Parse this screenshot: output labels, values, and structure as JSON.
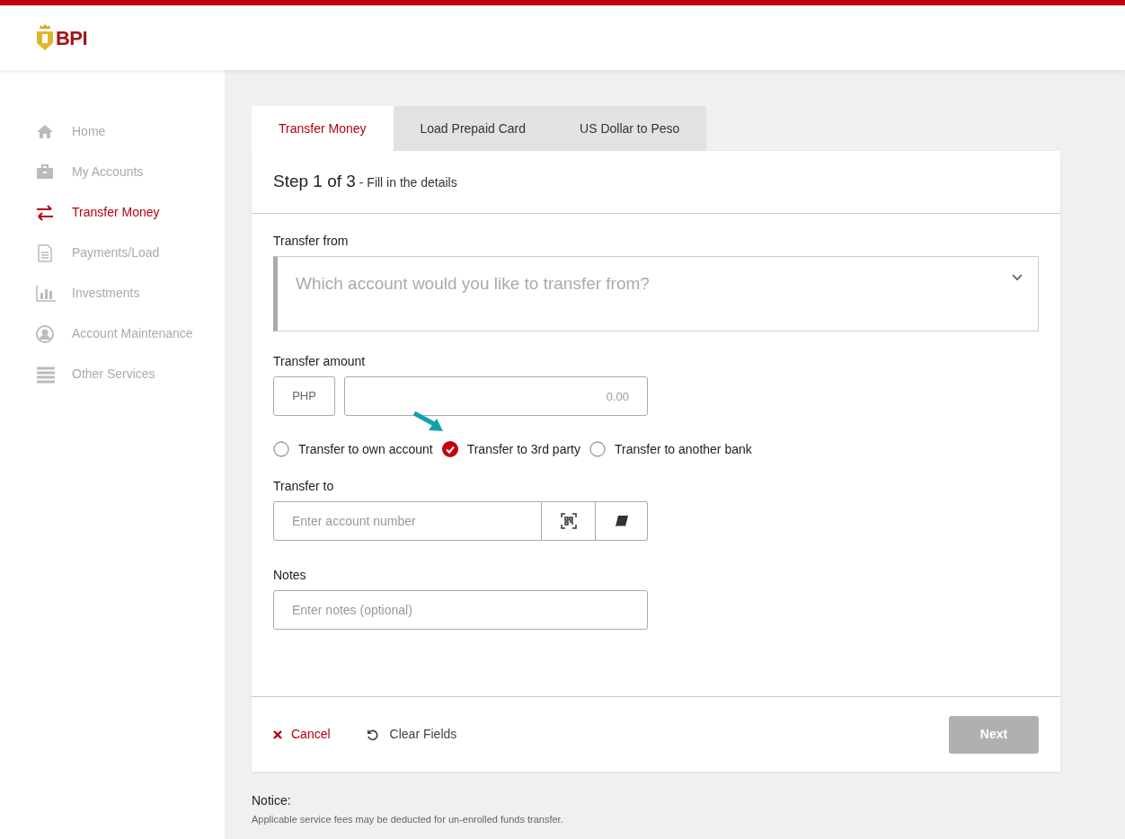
{
  "header": {
    "logo_text": "BPI"
  },
  "sidebar": {
    "items": [
      {
        "label": "Home",
        "selected": false
      },
      {
        "label": "My Accounts",
        "selected": false
      },
      {
        "label": "Transfer Money",
        "selected": true
      },
      {
        "label": "Payments/Load",
        "selected": false
      },
      {
        "label": "Investments",
        "selected": false
      },
      {
        "label": "Account Maintenance",
        "selected": false
      },
      {
        "label": "Other Services",
        "selected": false
      }
    ]
  },
  "tabs": [
    {
      "label": "Transfer Money",
      "selected": true
    },
    {
      "label": "Load Prepaid Card",
      "selected": false
    },
    {
      "label": "US Dollar to Peso",
      "selected": false
    }
  ],
  "step": {
    "title": "Step 1 of 3",
    "subtitle": " - Fill in the details"
  },
  "transfer_from": {
    "label": "Transfer from",
    "placeholder": "Which account would you like to transfer from?"
  },
  "transfer_amount": {
    "label": "Transfer amount",
    "currency": "PHP",
    "placeholder": "0.00"
  },
  "transfer_types": [
    {
      "label": "Transfer to own account",
      "selected": false
    },
    {
      "label": "Transfer to 3rd party",
      "selected": true
    },
    {
      "label": "Transfer to another bank",
      "selected": false
    }
  ],
  "transfer_to": {
    "label": "Transfer to",
    "placeholder": "Enter account number"
  },
  "notes": {
    "label": "Notes",
    "placeholder": "Enter notes (optional)"
  },
  "actions": {
    "cancel": "Cancel",
    "clear": "Clear Fields",
    "next": {
      "label": "Next",
      "disabled": true
    }
  },
  "notice": {
    "title": "Notice:",
    "text": "Applicable service fees may be deducted for un-enrolled funds transfer."
  }
}
